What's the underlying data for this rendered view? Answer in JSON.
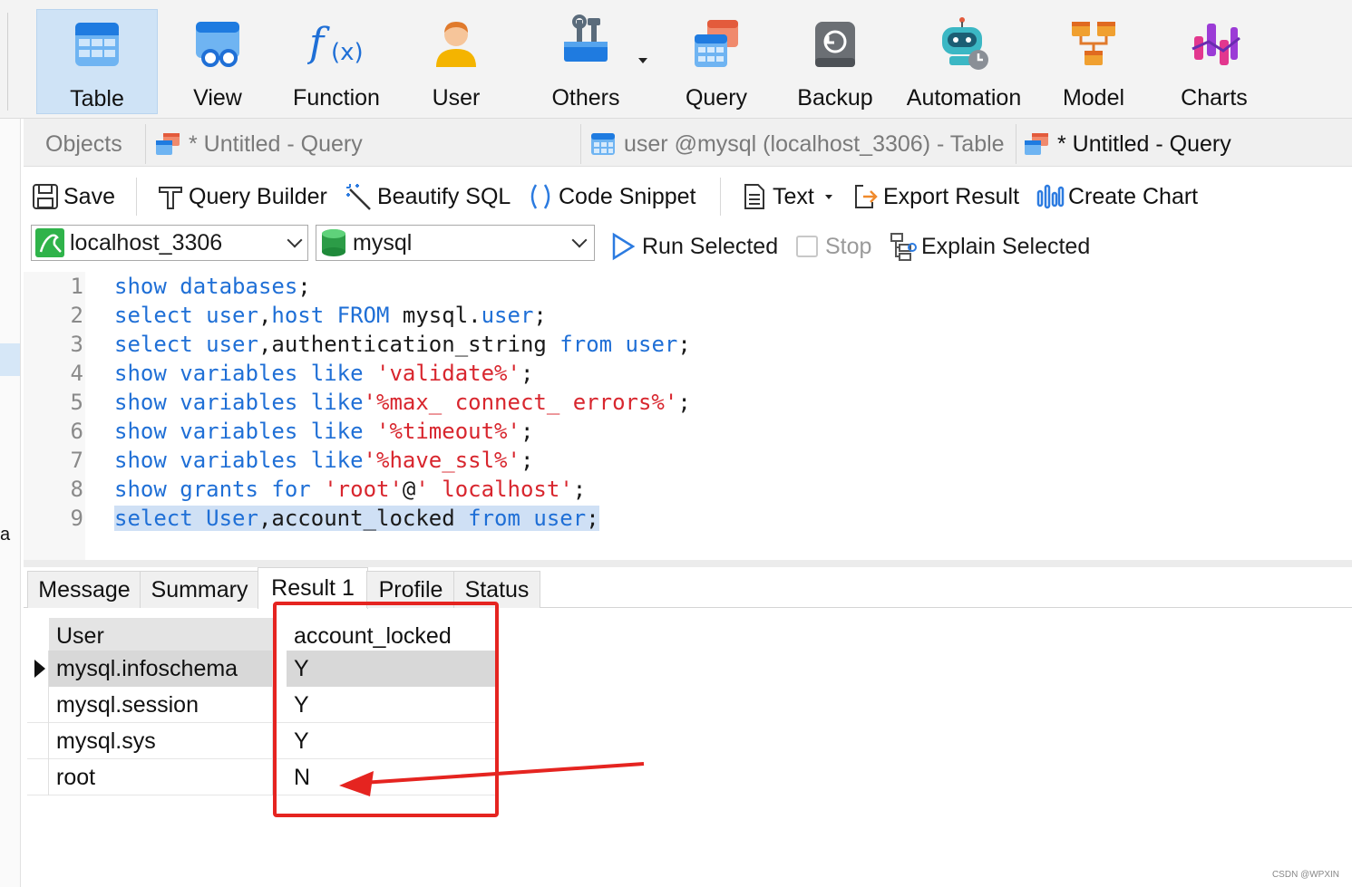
{
  "ribbon": {
    "items": [
      {
        "label": "Table",
        "icon": "table-icon",
        "active": true
      },
      {
        "label": "View",
        "icon": "view-icon"
      },
      {
        "label": "Function",
        "icon": "function-icon"
      },
      {
        "label": "User",
        "icon": "user-icon"
      },
      {
        "label": "Others",
        "icon": "others-icon"
      },
      {
        "label": "Query",
        "icon": "query-icon"
      },
      {
        "label": "Backup",
        "icon": "backup-icon"
      },
      {
        "label": "Automation",
        "icon": "automation-icon"
      },
      {
        "label": "Model",
        "icon": "model-icon"
      },
      {
        "label": "Charts",
        "icon": "charts-icon"
      }
    ]
  },
  "tabs": {
    "objects": "Objects",
    "query1": "* Untitled - Query",
    "table": "user @mysql (localhost_3306) - Table",
    "query2": "* Untitled - Query"
  },
  "toolbar": {
    "save": "Save",
    "query_builder": "Query Builder",
    "beautify": "Beautify SQL",
    "snippet": "Code Snippet",
    "text": "Text",
    "export": "Export Result",
    "create_chart": "Create Chart"
  },
  "connection": {
    "server": "localhost_3306",
    "database": "mysql",
    "run_selected": "Run Selected",
    "stop": "Stop",
    "explain_selected": "Explain Selected"
  },
  "editor": {
    "line_numbers": [
      "1",
      "2",
      "3",
      "4",
      "5",
      "6",
      "7",
      "8",
      "9"
    ]
  },
  "result_tabs": {
    "message": "Message",
    "summary": "Summary",
    "result1": "Result 1",
    "profile": "Profile",
    "status": "Status"
  },
  "grid": {
    "columns": [
      "User",
      "account_locked"
    ],
    "rows": [
      [
        "mysql.infoschema",
        "Y"
      ],
      [
        "mysql.session",
        "Y"
      ],
      [
        "mysql.sys",
        "Y"
      ],
      [
        "root",
        "N"
      ]
    ]
  },
  "watermark": "CSDN @WPXIN",
  "colors": {
    "keyword": "#1f6fd6",
    "string": "#d8262e",
    "annotation": "#e52420",
    "active_ribbon": "#cfe3f6"
  }
}
